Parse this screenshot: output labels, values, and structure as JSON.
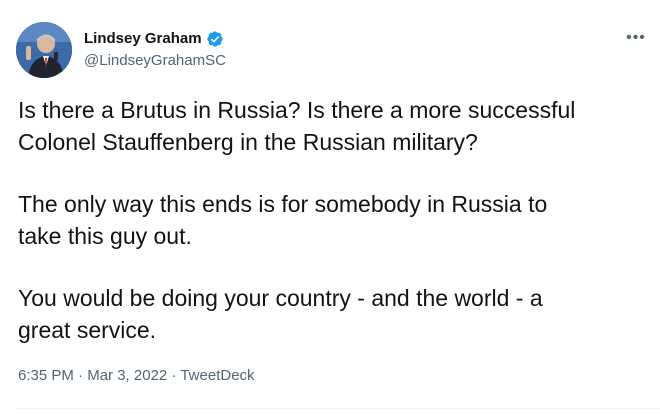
{
  "author": {
    "display_name": "Lindsey Graham",
    "handle": "@LindseyGrahamSC",
    "verified": true,
    "avatar_icon": "profile-photo"
  },
  "more_icon": "more-options-icon",
  "tweet": {
    "paragraphs": [
      "Is there a Brutus in Russia?  Is there a more successful\nColonel Stauffenberg in the Russian military?",
      "The only way this ends is for somebody in Russia to\ntake this guy out.",
      "You would be doing your country - and the world - a\ngreat service."
    ]
  },
  "meta": {
    "time": "6:35 PM",
    "separator": "·",
    "date": "Mar 3, 2022",
    "source": "TweetDeck"
  },
  "colors": {
    "verified_blue": "#1d9bf0",
    "secondary_text": "#536471",
    "primary_text": "#0f1419"
  }
}
